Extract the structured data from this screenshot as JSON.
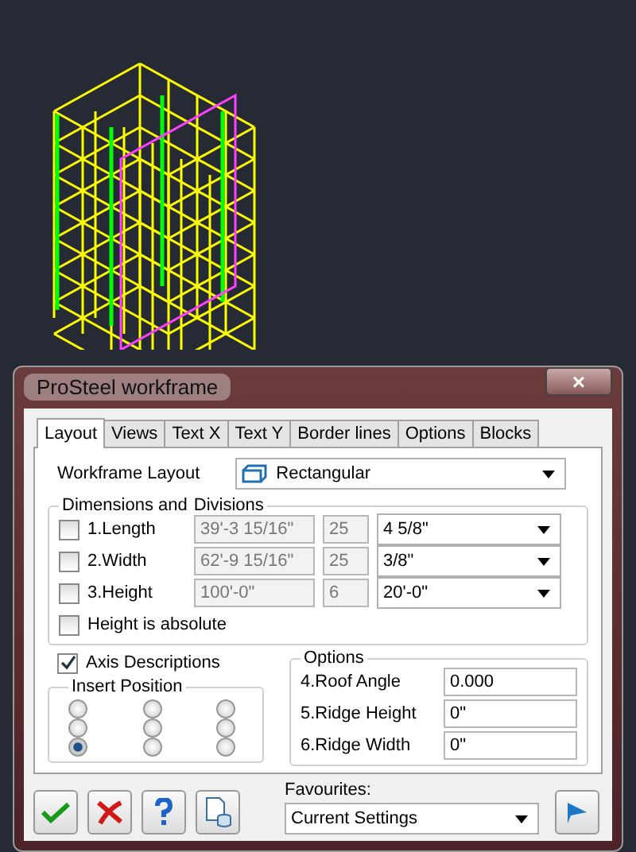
{
  "window": {
    "title": "ProSteel  workframe",
    "close": "×"
  },
  "tabs": [
    {
      "label": "Layout",
      "selected": true
    },
    {
      "label": "Views",
      "selected": false
    },
    {
      "label": "Text X",
      "selected": false
    },
    {
      "label": "Text Y",
      "selected": false
    },
    {
      "label": "Border lines",
      "selected": false
    },
    {
      "label": "Options",
      "selected": false
    },
    {
      "label": "Blocks",
      "selected": false
    }
  ],
  "layout": {
    "label": "Workframe Layout",
    "value": "Rectangular"
  },
  "dimensions": {
    "title_1": "Dimensions and",
    "title_2": "Divisions",
    "rows": [
      {
        "label": "1.Length",
        "checked": false,
        "size": "39'-3 15/16\"",
        "count": "25",
        "division": "4 5/8\""
      },
      {
        "label": "2.Width",
        "checked": false,
        "size": "62'-9 15/16\"",
        "count": "25",
        "division": "3/8\""
      },
      {
        "label": "3.Height",
        "checked": false,
        "size": "100'-0\"",
        "count": "6",
        "division": "20'-0\""
      }
    ],
    "height_absolute": {
      "label": "Height is absolute",
      "checked": false
    }
  },
  "axis_descriptions": {
    "label": "Axis Descriptions",
    "checked": true
  },
  "insert_position": {
    "title": "Insert Position",
    "options": [
      {
        "selected": false
      },
      {
        "selected": false
      },
      {
        "selected": false
      },
      {
        "selected": false
      },
      {
        "selected": false
      },
      {
        "selected": false
      },
      {
        "selected": true
      },
      {
        "selected": false
      },
      {
        "selected": false
      }
    ]
  },
  "options": {
    "title": "Options",
    "fields": [
      {
        "label": "4.Roof Angle",
        "value": "0.000"
      },
      {
        "label": "5.Ridge Height",
        "value": "0\""
      },
      {
        "label": "6.Ridge Width",
        "value": "0\""
      }
    ]
  },
  "favourites": {
    "label": "Favourites:",
    "value": "Current Settings"
  }
}
